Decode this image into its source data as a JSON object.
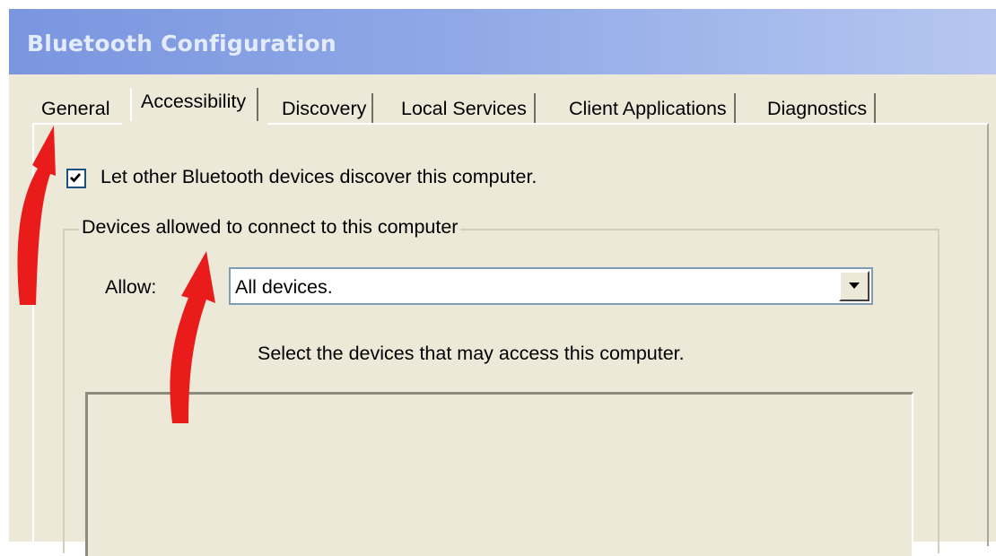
{
  "window": {
    "title": "Bluetooth Configuration"
  },
  "tabs": [
    {
      "label": "General"
    },
    {
      "label": "Accessibility",
      "active": true
    },
    {
      "label": "Discovery"
    },
    {
      "label": "Local Services"
    },
    {
      "label": "Client Applications"
    },
    {
      "label": "Diagnostics"
    }
  ],
  "discover": {
    "label": "Let other Bluetooth devices discover this computer.",
    "checked": true
  },
  "group": {
    "legend": "Devices allowed to connect to this computer",
    "allow_label": "Allow:",
    "allow_value": "All devices.",
    "description": "Select the devices that may access this computer."
  },
  "annotations": {
    "arrow_color": "#ea1b1b"
  },
  "colors": {
    "dialog_bg": "#ece9d8",
    "title_fg": "#e4ebfb"
  }
}
